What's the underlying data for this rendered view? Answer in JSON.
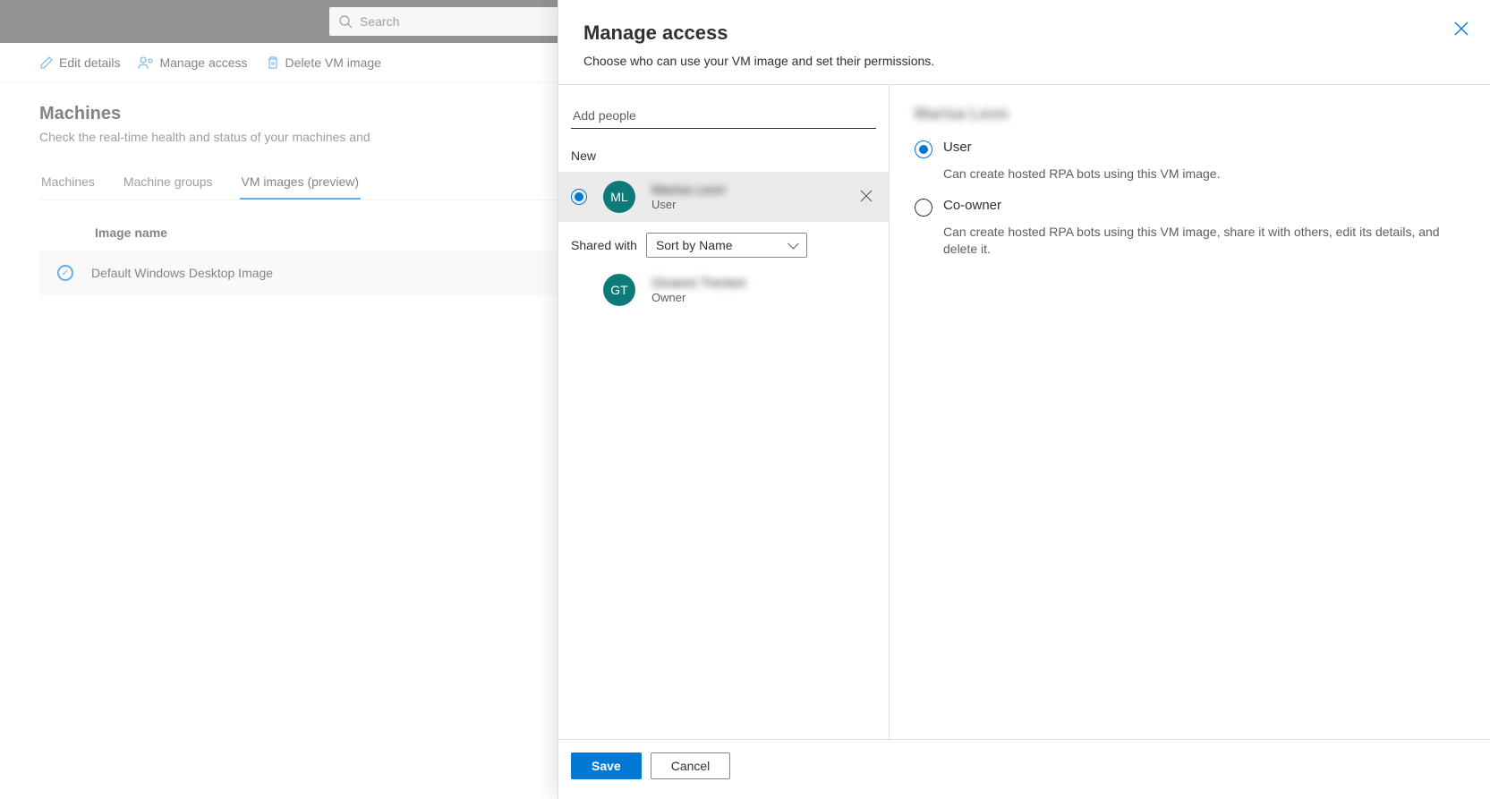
{
  "topbar": {
    "search_placeholder": "Search"
  },
  "commands": {
    "edit": "Edit details",
    "manage_access": "Manage access",
    "delete": "Delete VM image"
  },
  "page": {
    "title": "Machines",
    "description": "Check the real-time health and status of your machines and"
  },
  "tabs": {
    "machines": "Machines",
    "groups": "Machine groups",
    "images": "VM images (preview)"
  },
  "table": {
    "col_image_name": "Image name",
    "row0": {
      "name": "Default Windows Desktop Image"
    }
  },
  "panel": {
    "title": "Manage access",
    "description": "Choose who can use your VM image and set their permissions.",
    "add_people_placeholder": "Add people",
    "new_label": "New",
    "shared_with_label": "Shared with",
    "sort_by": "Sort by Name",
    "new_person": {
      "initials": "ML",
      "name": "Marisa Leon",
      "role": "User"
    },
    "owner_person": {
      "initials": "GT",
      "name": "Givanni Trenton",
      "role": "Owner"
    },
    "perm_section_name": "Marisa Leon",
    "perm_user": {
      "label": "User",
      "desc": "Can create hosted RPA bots using this VM image."
    },
    "perm_coowner": {
      "label": "Co-owner",
      "desc": "Can create hosted RPA bots using this VM image, share it with others, edit its details, and delete it."
    },
    "save": "Save",
    "cancel": "Cancel"
  }
}
